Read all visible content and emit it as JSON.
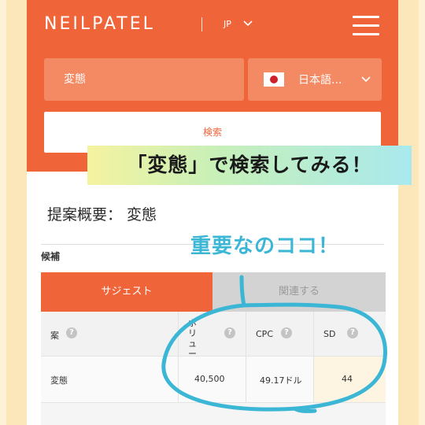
{
  "header": {
    "logo": "NEILPATEL",
    "lang_code": "JP"
  },
  "search": {
    "keyword": "変態",
    "language_label": "日本語...",
    "button_label": "検索"
  },
  "banner": {
    "text": "「変態」で検索してみる！"
  },
  "summary": {
    "title": "提案概要： 変態",
    "section_label": "候補"
  },
  "tabs": [
    {
      "label": "サジェスト"
    },
    {
      "label": "関連する"
    }
  ],
  "table": {
    "columns": [
      {
        "label": "案"
      },
      {
        "label": "ボリューム"
      },
      {
        "label": "CPC"
      },
      {
        "label": "SD"
      }
    ],
    "rows": [
      {
        "keyword": "変態",
        "volume": "40,500",
        "cpc": "49.17ドル",
        "sd": "44"
      }
    ]
  },
  "annotation": {
    "note": "重要なのココ！"
  },
  "colors": {
    "brand": "#f0643a",
    "annotation": "#3bb6d5"
  },
  "icons": {
    "menu": "hamburger-menu-icon",
    "flag": "japan-flag-icon",
    "help": "question-mark-icon"
  }
}
